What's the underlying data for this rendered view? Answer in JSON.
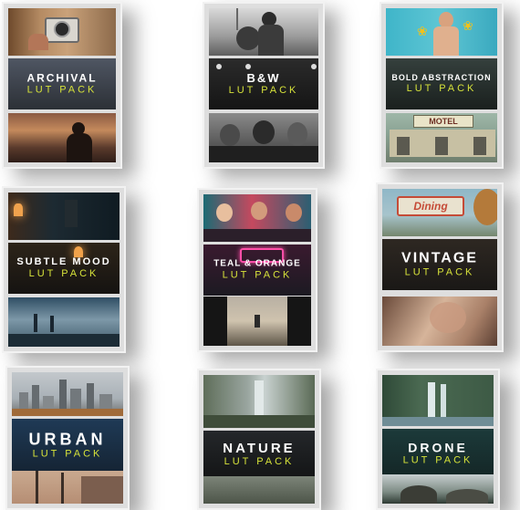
{
  "cards": [
    {
      "title": "ARCHIVAL",
      "subtitle": "LUT PACK"
    },
    {
      "title": "B&W",
      "subtitle": "LUT PACK"
    },
    {
      "title": "BOLD ABSTRACTION",
      "subtitle": "LUT PACK"
    },
    {
      "title": "SUBTLE MOOD",
      "subtitle": "LUT PACK"
    },
    {
      "title": "TEAL & ORANGE",
      "subtitle": "LUT PACK"
    },
    {
      "title": "VINTAGE",
      "subtitle": "LUT PACK"
    },
    {
      "title": "URBAN",
      "subtitle": "LUT PACK"
    },
    {
      "title": "NATURE",
      "subtitle": "LUT PACK"
    },
    {
      "title": "DRONE",
      "subtitle": "LUT PACK"
    }
  ],
  "photo_signs": {
    "motel": "MOTEL",
    "dining": "Dining"
  },
  "colors": {
    "subtitle_accent": "#d6e23a",
    "title_text": "#ffffff",
    "title_band": "#1b1b1c",
    "card_frame": "#f2f2f2"
  }
}
